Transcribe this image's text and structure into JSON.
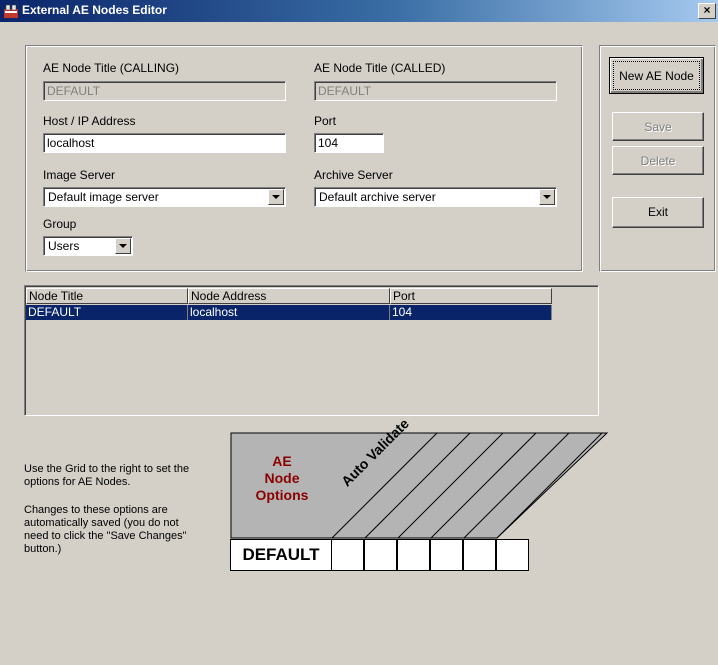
{
  "window": {
    "title": "External AE Nodes Editor",
    "close": "×"
  },
  "form": {
    "calling_label": "AE Node Title (CALLING)",
    "calling_value": "DEFAULT",
    "called_label": "AE Node Title (CALLED)",
    "called_value": "DEFAULT",
    "host_label": "Host / IP Address",
    "host_value": "localhost",
    "port_label": "Port",
    "port_value": "104",
    "image_server_label": "Image Server",
    "image_server_value": "Default image server",
    "archive_server_label": "Archive Server",
    "archive_server_value": "Default archive server",
    "group_label": "Group",
    "group_value": "Users"
  },
  "buttons": {
    "new": "New AE Node",
    "save": "Save",
    "delete": "Delete",
    "exit": "Exit"
  },
  "grid": {
    "columns": [
      "Node Title",
      "Node Address",
      "Port"
    ],
    "rows": [
      [
        "DEFAULT",
        "localhost",
        "104"
      ]
    ]
  },
  "help": {
    "line1": "Use the Grid to the right to set the options for AE Nodes.",
    "line2": "Changes to these options are automatically saved (you do not need to click the \"Save Changes\" button.)"
  },
  "options": {
    "header_line1": "AE",
    "header_line2": "Node",
    "header_line3": "Options",
    "column_label": "Auto Validate",
    "row_label": "DEFAULT",
    "header_color": "#8b0000"
  }
}
